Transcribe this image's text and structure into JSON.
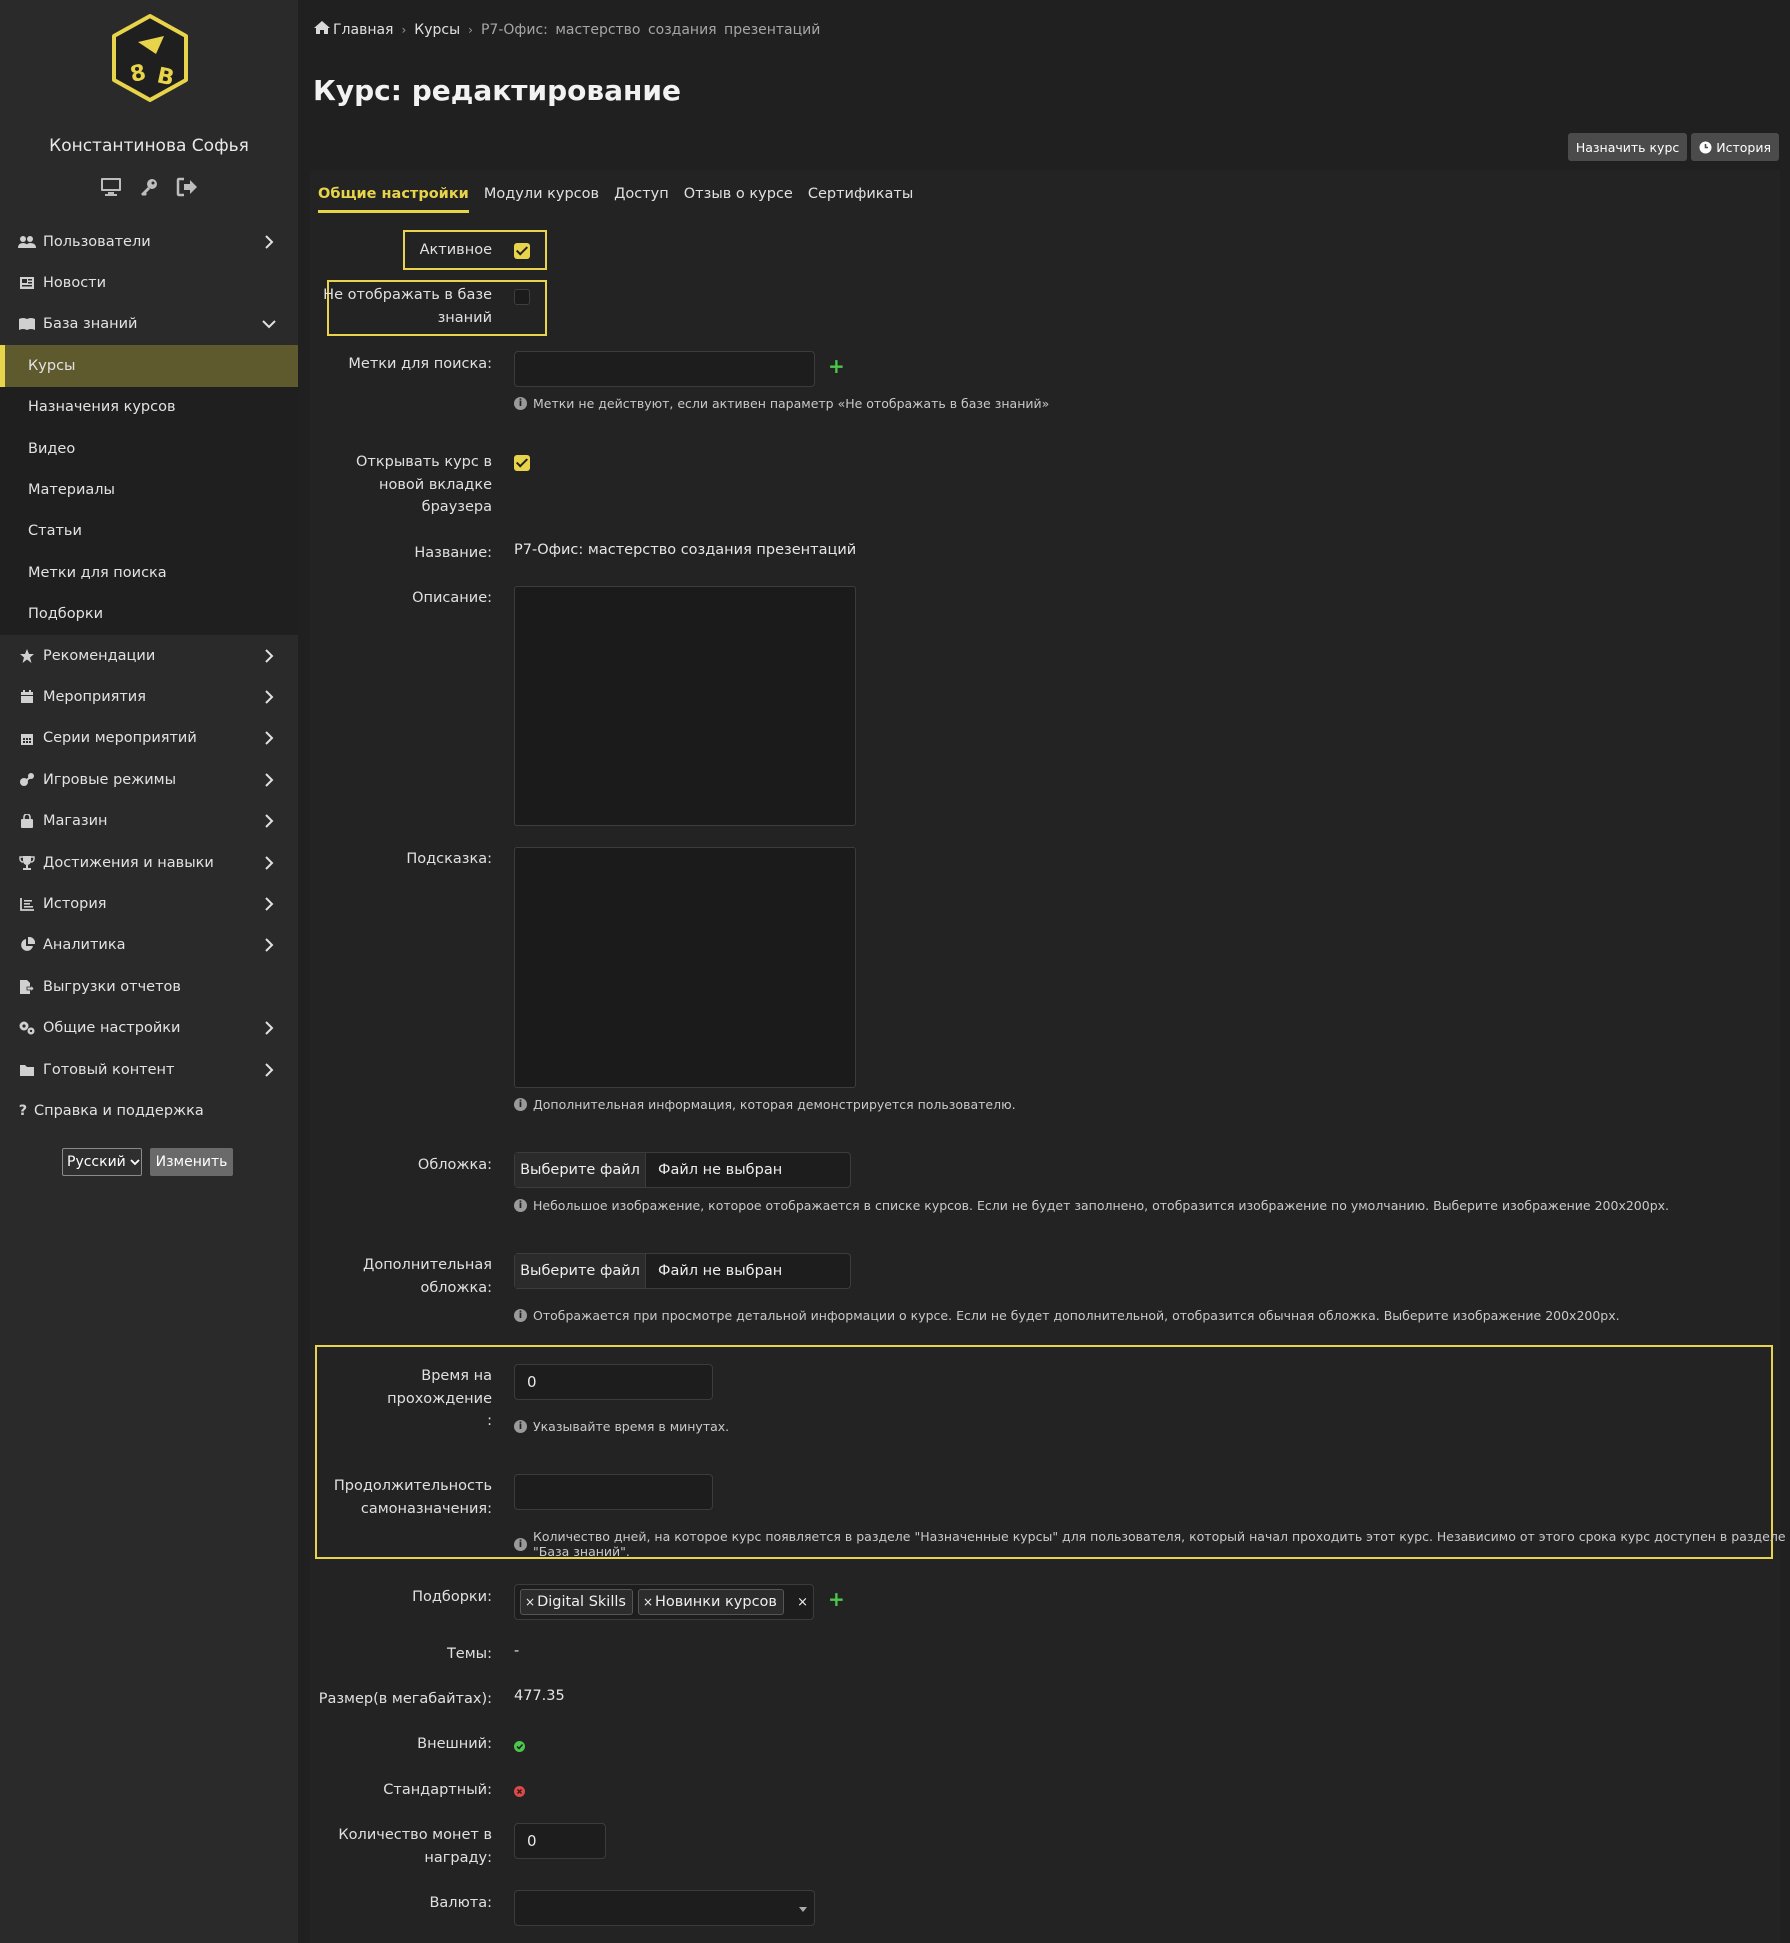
{
  "sidebar": {
    "user_name": "Константинова Софья",
    "items": [
      {
        "label": "Пользователи",
        "icon": "users-icon",
        "chevron": true
      },
      {
        "label": "Новости",
        "icon": "newspaper-icon",
        "chevron": false
      },
      {
        "label": "База знаний",
        "icon": "book-icon",
        "chevron": "down"
      }
    ],
    "sub_items": [
      {
        "label": "Курсы",
        "active": true
      },
      {
        "label": "Назначения курсов"
      },
      {
        "label": "Видео"
      },
      {
        "label": "Материалы"
      },
      {
        "label": "Статьи"
      },
      {
        "label": "Метки для поиска"
      },
      {
        "label": "Подборки"
      }
    ],
    "items_after": [
      {
        "label": "Рекомендации",
        "icon": "star-icon",
        "chevron": true
      },
      {
        "label": "Мероприятия",
        "icon": "calendar-icon",
        "chevron": true
      },
      {
        "label": "Серии мероприятий",
        "icon": "calendar-grid-icon",
        "chevron": true
      },
      {
        "label": "Игровые режимы",
        "icon": "game-icon",
        "chevron": true
      },
      {
        "label": "Магазин",
        "icon": "bag-icon",
        "chevron": true
      },
      {
        "label": "Достижения и навыки",
        "icon": "trophy-icon",
        "chevron": true
      },
      {
        "label": "История",
        "icon": "chart-icon",
        "chevron": true
      },
      {
        "label": "Аналитика",
        "icon": "pie-icon",
        "chevron": true
      },
      {
        "label": "Выгрузки отчетов",
        "icon": "export-icon",
        "chevron": false
      },
      {
        "label": "Общие настройки",
        "icon": "gears-icon",
        "chevron": true
      },
      {
        "label": "Готовый контент",
        "icon": "folder-icon",
        "chevron": true
      },
      {
        "label": "Справка и поддержка",
        "icon": "question-icon",
        "chevron": false
      }
    ],
    "language": "Русский",
    "change_label": "Изменить"
  },
  "breadcrumb": {
    "home": "Главная",
    "courses": "Курсы",
    "current": "Р7-Офис: мастерство создания презентаций"
  },
  "page_title": "Курс: редактирование",
  "buttons": {
    "assign": "Назначить курс",
    "history": "История"
  },
  "tabs": [
    "Общие настройки",
    "Модули курсов",
    "Доступ",
    "Отзыв о курсе",
    "Сертификаты"
  ],
  "form": {
    "active_label": "Активное",
    "hide_label_1": "Не отображать в базе",
    "hide_label_2": "знаний",
    "tags_label": "Метки для поиска:",
    "tags_help": "Метки не действуют, если активен параметр «Не отображать в базе знаний»",
    "newtab_label_1": "Открывать курс в",
    "newtab_label_2": "новой вкладке",
    "newtab_label_3": "браузера",
    "name_label": "Название:",
    "name_value": "Р7-Офис: мастерство создания презентаций",
    "desc_label": "Описание:",
    "hint_label": "Подсказка:",
    "hint_help": "Дополнительная информация, которая демонстрируется пользователю.",
    "cover_label": "Обложка:",
    "file_button": "Выберите файл",
    "file_none": "Файл не выбран",
    "cover_help": "Небольшое изображение, которое отображается в списке курсов. Если не будет заполнено, отобразится изображение по умолчанию. Выберите изображение 200х200px.",
    "extra_cover_label_1": "Дополнительная",
    "extra_cover_label_2": "обложка:",
    "extra_cover_help": "Отображается при просмотре детальной информации о курсе. Если не будет дополнительной, отобразится обычная обложка. Выберите изображение 200х200px.",
    "time_label_1": "Время на прохождение",
    "time_label_2": ":",
    "time_value": "0",
    "time_help": "Указывайте время в минутах.",
    "selfassign_label_1": "Продолжительность",
    "selfassign_label_2": "самоназначения:",
    "selfassign_help": "Количество дней, на которое курс появляется в разделе \"Назначенные курсы\" для пользователя, который начал проходить этот курс. Независимо от этого срока курс доступен в разделе \"База знаний\".",
    "collections_label": "Подборки:",
    "collections": [
      "Digital Skills",
      "Новинки курсов"
    ],
    "themes_label": "Темы:",
    "themes_value": "-",
    "size_label": "Размер(в мегабайтах):",
    "size_value": "477.35",
    "external_label": "Внешний:",
    "standard_label": "Стандартный:",
    "coins_label_1": "Количество монет в",
    "coins_label_2": "награду:",
    "coins_value": "0",
    "currency_label": "Валюта:"
  },
  "colors": {
    "accent": "#e8d44a",
    "ok": "#4bc84b",
    "bad": "#e04848"
  }
}
